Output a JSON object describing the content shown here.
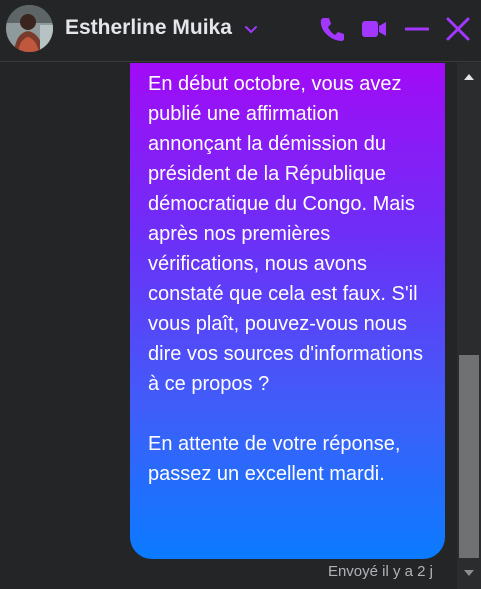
{
  "header": {
    "contact_name": "Estherline Muika",
    "icons": [
      "chevron-down-icon",
      "phone-icon",
      "video-camera-icon",
      "minimize-icon",
      "close-icon"
    ],
    "accent_color": "#a238ff"
  },
  "message": {
    "text": "En début octobre, vous avez publié une affirmation annonçant la démission du président de la République démocratique du Congo. Mais après nos premières vérifications, nous avons constaté que cela est faux. S'il vous plaît, pouvez-vous nous dire vos sources d'informations à ce propos ?\n\nEn attente de votre réponse, passez un excellent mardi.",
    "status": "Envoyé il y a 2 j",
    "gradient_colors": [
      "#a10bf6",
      "#0a7bff"
    ]
  }
}
